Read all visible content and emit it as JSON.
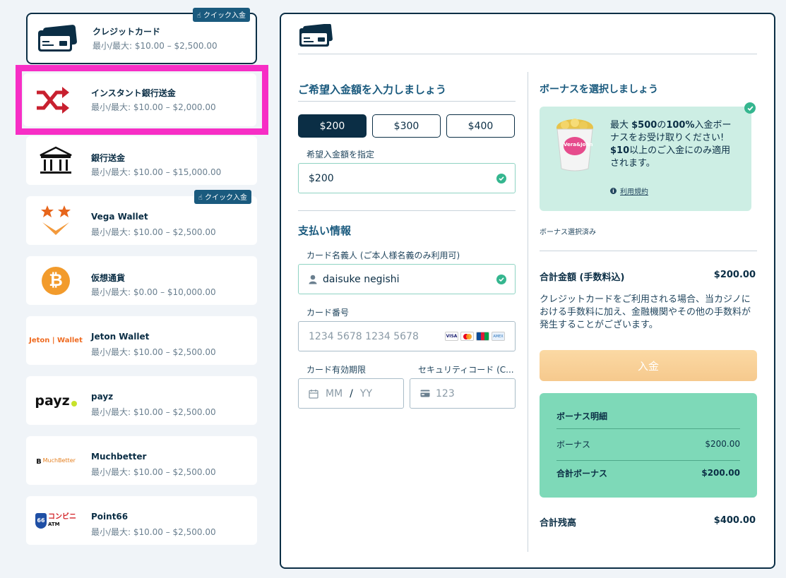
{
  "methods": [
    {
      "name": "クレジットカード",
      "range": "最小/最大: $10.00 – $2,500.00",
      "badge": "クイック入金",
      "icon": "credit-card-icon",
      "selected": true
    },
    {
      "name": "インスタント銀行送金",
      "range": "最小/最大: $10.00 – $2,000.00",
      "badge": "",
      "icon": "shuffle-icon"
    },
    {
      "name": "銀行送金",
      "range": "最小/最大: $10.00 – $15,000.00",
      "badge": "",
      "icon": "bank-icon"
    },
    {
      "name": "Vega Wallet",
      "range": "最小/最大: $10.00 – $2,500.00",
      "badge": "クイック入金",
      "icon": "vega-wallet-logo"
    },
    {
      "name": "仮想通貨",
      "range": "最小/最大: $0.00 – $10,000.00",
      "badge": "",
      "icon": "bitcoin-icon"
    },
    {
      "name": "Jeton Wallet",
      "range": "最小/最大: $10.00 – $2,500.00",
      "badge": "",
      "icon": "jeton-logo",
      "logo_text": "Jeton | Wallet"
    },
    {
      "name": "payz",
      "range": "最小/最大: $10.00 – $2,500.00",
      "badge": "",
      "icon": "payz-logo",
      "logo_text": "payz"
    },
    {
      "name": "Muchbetter",
      "range": "最小/最大: $10.00 – $2,500.00",
      "badge": "",
      "icon": "muchbetter-logo",
      "logo_text": "MuchBetter"
    },
    {
      "name": "Point66",
      "range": "最小/最大: $10.00 – $2,500.00",
      "badge": "",
      "icon": "point66-logo",
      "logo_text": "コンビニ"
    }
  ],
  "deposit": {
    "amount_title": "ご希望入金額を入力しましょう",
    "presets": [
      "$200",
      "$300",
      "$400"
    ],
    "active_preset": 0,
    "custom_label": "希望入金額を指定",
    "custom_value": "$200",
    "payment_title": "支払い情報",
    "holder_label": "カード名義人 (ご本人様名義のみ利用可)",
    "holder_value": "daisuke negishi",
    "number_label": "カード番号",
    "number_placeholder": "1234 5678 1234 5678",
    "expiry_label": "カード有効期限",
    "expiry_mm": "MM",
    "expiry_sep": "/",
    "expiry_yy": "YY",
    "cvc_label": "セキュリティコード (C...",
    "cvc_placeholder": "123",
    "card_brands": [
      "VISA",
      "Mastercard",
      "JCB",
      "AMEX"
    ]
  },
  "bonus": {
    "title": "ボーナスを選択しましょう",
    "line1_pre": "最大 ",
    "line1_amount": "$500",
    "line1_mid": "の",
    "line1_pct": "100%",
    "line1_post": "入金ボーナスをお受け取りください!",
    "line2_amount": "$10",
    "line2_post": "以上のご入金にのみ適用されます。",
    "terms": "利用規約",
    "selected_note": "ボーナス選択済み",
    "image_text": "Vera&John"
  },
  "summary": {
    "total_label": "合計金額 (手数料込)",
    "total_value": "$200.00",
    "notice": "クレジットカードをご利用される場合、当カジノにおける手数料に加え、金融機関やその他の手数料が発生することがございます。",
    "deposit_button": "入金",
    "breakdown_title": "ボーナス明細",
    "bonus_label": "ボーナス",
    "bonus_value": "$200.00",
    "total_bonus_label": "合計ボーナス",
    "total_bonus_value": "$200.00",
    "balance_label": "合計残高",
    "balance_value": "$400.00"
  },
  "colors": {
    "primary": "#0b2e45",
    "accent": "#1a5a7e",
    "highlight": "#f72ec5",
    "bonus_bg": "#cdeee4",
    "breakdown_bg": "#7ed9b8",
    "deposit_btn": "#f6c98d"
  }
}
